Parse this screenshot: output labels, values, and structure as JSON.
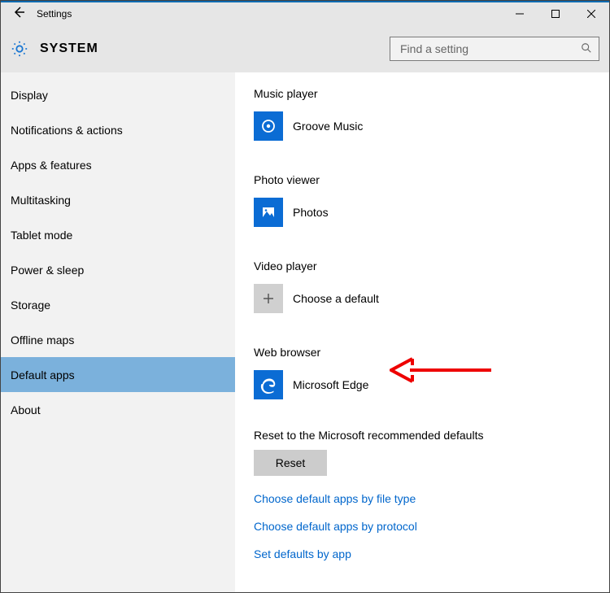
{
  "window": {
    "title": "Settings"
  },
  "header": {
    "section": "SYSTEM"
  },
  "search": {
    "placeholder": "Find a setting"
  },
  "sidebar": {
    "items": [
      {
        "label": "Display"
      },
      {
        "label": "Notifications & actions"
      },
      {
        "label": "Apps & features"
      },
      {
        "label": "Multitasking"
      },
      {
        "label": "Tablet mode"
      },
      {
        "label": "Power & sleep"
      },
      {
        "label": "Storage"
      },
      {
        "label": "Offline maps"
      },
      {
        "label": "Default apps"
      },
      {
        "label": "About"
      }
    ]
  },
  "content": {
    "categories": [
      {
        "label": "Music player",
        "app": "Groove Music",
        "iconColor": "#0b6cd4"
      },
      {
        "label": "Photo viewer",
        "app": "Photos",
        "iconColor": "#0b6cd4"
      },
      {
        "label": "Video player",
        "app": "Choose a default",
        "iconColor": "#d0d0d0"
      },
      {
        "label": "Web browser",
        "app": "Microsoft Edge",
        "iconColor": "#0b6cd4"
      }
    ],
    "reset_text": "Reset to the Microsoft recommended defaults",
    "reset_button": "Reset",
    "links": [
      "Choose default apps by file type",
      "Choose default apps by protocol",
      "Set defaults by app"
    ]
  }
}
